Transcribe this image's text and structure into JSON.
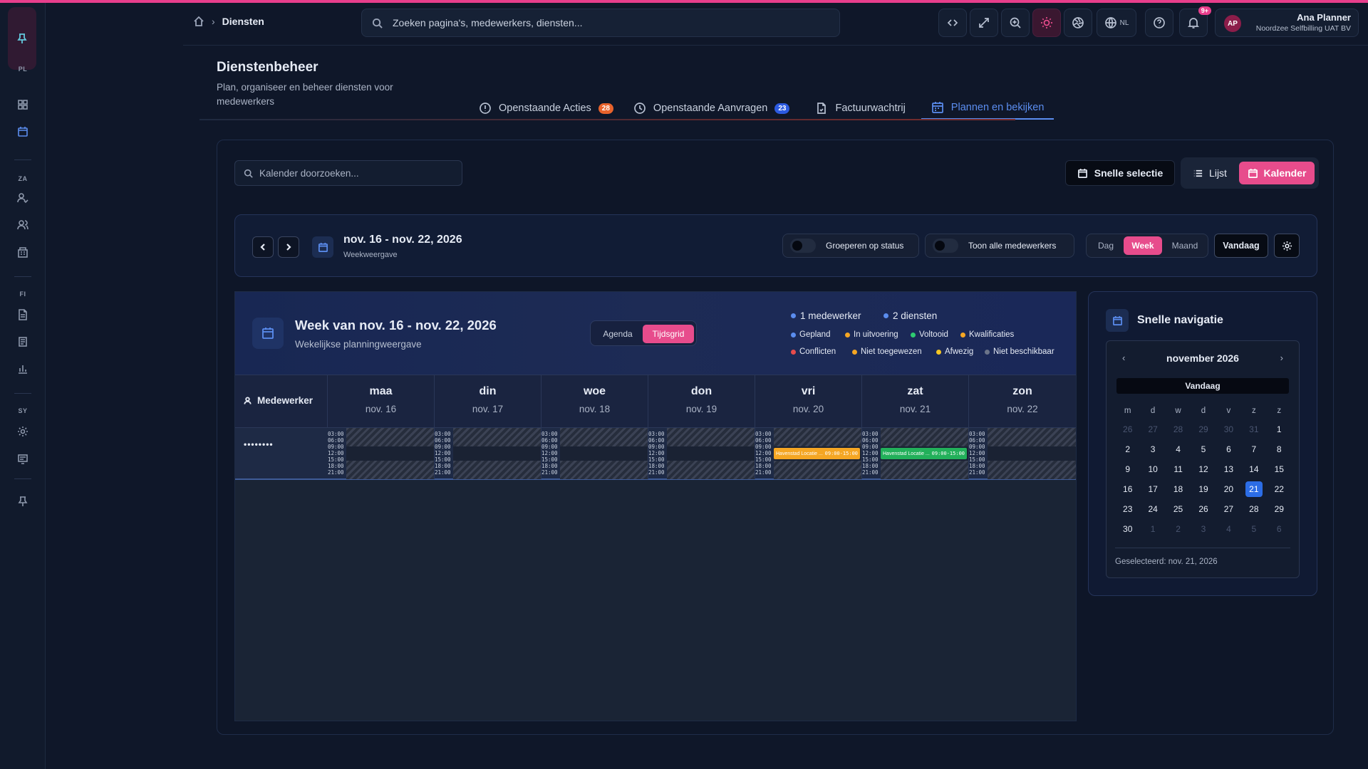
{
  "colors": {
    "accent_pink": "#e74c8c",
    "accent_blue": "#5b8def",
    "background": "#0f1729"
  },
  "sidebar": {
    "sections": [
      {
        "label": "PL",
        "items": [
          {
            "icon": "grid-icon"
          },
          {
            "icon": "calendar-icon",
            "active": true
          }
        ]
      },
      {
        "label": "ZA",
        "items": [
          {
            "icon": "user-check-icon"
          },
          {
            "icon": "users-icon"
          },
          {
            "icon": "building-icon"
          }
        ]
      },
      {
        "label": "FI",
        "items": [
          {
            "icon": "file-text-icon"
          },
          {
            "icon": "receipt-icon"
          },
          {
            "icon": "bar-chart-icon"
          }
        ]
      },
      {
        "label": "SY",
        "items": [
          {
            "icon": "gear-icon"
          },
          {
            "icon": "monitor-icon"
          }
        ]
      }
    ],
    "footer_icon": "pin-icon"
  },
  "header": {
    "breadcrumb": {
      "current": "Diensten"
    },
    "search_placeholder": "Zoeken pagina's, medewerkers, diensten...",
    "language": "NL",
    "notifications_badge": "9+",
    "user": {
      "initials": "AP",
      "name": "Ana Planner",
      "organization": "Noordzee Selfbilling UAT BV"
    }
  },
  "page": {
    "title": "Dienstenbeheer",
    "subtitle": "Plan, organiseer en beheer diensten voor medewerkers",
    "tabs": [
      {
        "label": "Openstaande Acties",
        "badge": "28",
        "badge_color": "#e8632c",
        "icon": "alert-circle-icon"
      },
      {
        "label": "Openstaande Aanvragen",
        "badge": "23",
        "badge_color": "#2c5ae0",
        "icon": "clock-icon"
      },
      {
        "label": "Factuurwachtrij",
        "badge": "",
        "icon": "file-check-icon"
      },
      {
        "label": "Plannen en bekijken",
        "badge": "",
        "icon": "calendar-range-icon",
        "active": true
      }
    ]
  },
  "toolbar": {
    "calendar_search_placeholder": "Kalender doorzoeken...",
    "quick_select_label": "Snelle selectie",
    "view_list_label": "Lijst",
    "view_calendar_label": "Kalender"
  },
  "datebar": {
    "range": "nov. 16 - nov. 22, 2026",
    "view_label": "Weekweergave",
    "group_by_status_label": "Groeperen op status",
    "show_all_employees_label": "Toon alle medewerkers",
    "modes": [
      "Dag",
      "Week",
      "Maand"
    ],
    "active_mode": "Week",
    "today_label": "Vandaag"
  },
  "calendar": {
    "title": "Week van nov. 16 - nov. 22, 2026",
    "subtitle": "Wekelijkse planningweergave",
    "view_toggle": [
      "Agenda",
      "Tijdsgrid"
    ],
    "active_view": "Tijdsgrid",
    "stats": [
      {
        "label": "1 medewerker",
        "color": "#5b8def"
      },
      {
        "label": "2 diensten",
        "color": "#5b8def"
      }
    ],
    "legend": [
      {
        "label": "Gepland",
        "color": "#5b8def"
      },
      {
        "label": "In uitvoering",
        "color": "#f5a623"
      },
      {
        "label": "Voltooid",
        "color": "#2ecc71"
      },
      {
        "label": "Kwalificaties",
        "color": "#f5a623"
      },
      {
        "label": "Conflicten",
        "color": "#e74c4c"
      },
      {
        "label": "Niet toegewezen",
        "color": "#f5a623"
      },
      {
        "label": "Afwezig",
        "color": "#f5c623"
      },
      {
        "label": "Niet beschikbaar",
        "color": "#6b7489"
      }
    ],
    "employee_header": "Medewerker",
    "days": [
      {
        "name": "maa",
        "date": "nov. 16"
      },
      {
        "name": "din",
        "date": "nov. 17"
      },
      {
        "name": "woe",
        "date": "nov. 18"
      },
      {
        "name": "don",
        "date": "nov. 19"
      },
      {
        "name": "vri",
        "date": "nov. 20"
      },
      {
        "name": "zat",
        "date": "nov. 21"
      },
      {
        "name": "zon",
        "date": "nov. 22"
      }
    ],
    "hours": [
      "03:00",
      "06:00",
      "09:00",
      "12:00",
      "15:00",
      "18:00",
      "21:00"
    ],
    "employee": {
      "name": "••••••••"
    },
    "shifts": [
      {
        "day": 4,
        "label": "Havenstad Locatie ...",
        "time": "09:00-15:00",
        "color": "#f5a623"
      },
      {
        "day": 5,
        "label": "Havenstad Locatie ...",
        "time": "09:00-15:00",
        "color": "#22b05a"
      }
    ]
  },
  "quick_nav": {
    "title": "Snelle navigatie",
    "month": "november 2026",
    "today_label": "Vandaag",
    "weekdays": [
      "m",
      "d",
      "w",
      "d",
      "v",
      "z",
      "z"
    ],
    "weeks": [
      [
        "26",
        "27",
        "28",
        "29",
        "30",
        "31",
        "1"
      ],
      [
        "2",
        "3",
        "4",
        "5",
        "6",
        "7",
        "8"
      ],
      [
        "9",
        "10",
        "11",
        "12",
        "13",
        "14",
        "15"
      ],
      [
        "16",
        "17",
        "18",
        "19",
        "20",
        "21",
        "22"
      ],
      [
        "23",
        "24",
        "25",
        "26",
        "27",
        "28",
        "29"
      ],
      [
        "30",
        "1",
        "2",
        "3",
        "4",
        "5",
        "6"
      ]
    ],
    "selected_day": "21",
    "selected_text": "Geselecteerd: nov. 21, 2026"
  }
}
